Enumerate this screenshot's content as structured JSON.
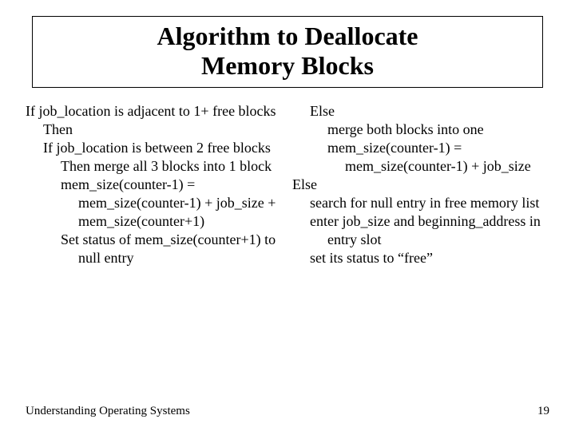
{
  "title": {
    "line1": "Algorithm to Deallocate",
    "line2": "Memory Blocks"
  },
  "left": {
    "p0": "If job_location is adjacent to 1+ free blocks",
    "p1": "Then",
    "p2": "If job_location is between 2 free blocks",
    "p3": "Then merge all 3 blocks into 1 block",
    "p4": "mem_size(counter-1) = mem_size(counter-1) + job_size + mem_size(counter+1)",
    "p5": "Set status of mem_size(counter+1) to null entry"
  },
  "right": {
    "p0": "Else",
    "p1": "merge both blocks into one",
    "p2": "mem_size(counter-1) = mem_size(counter-1) + job_size",
    "p3": "Else",
    "p4": "search for null entry in free memory list",
    "p5": "enter job_size and beginning_address in entry slot",
    "p6": "set its status to “free”"
  },
  "footer": {
    "left": "Understanding Operating Systems",
    "right": "19"
  }
}
